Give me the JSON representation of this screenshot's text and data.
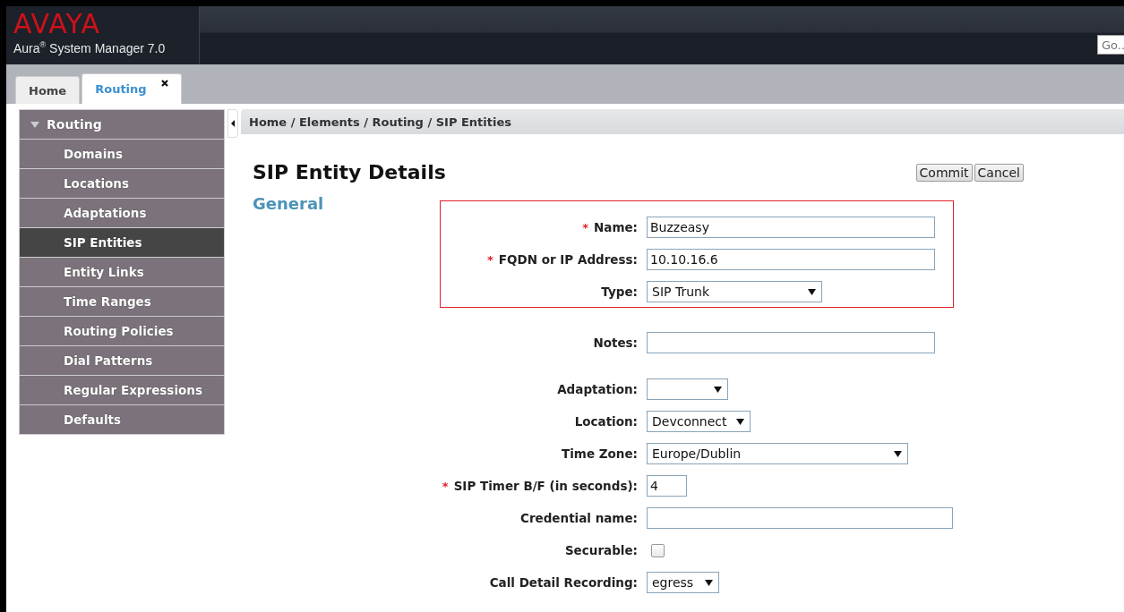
{
  "header": {
    "logo": "AVAYA",
    "product": "Aura",
    "product_mark": "®",
    "product_suffix": "System Manager 7.0",
    "search": {
      "placeholder": "Go.."
    }
  },
  "tabs": [
    {
      "label": "Home",
      "selected": false,
      "closable": false
    },
    {
      "label": "Routing",
      "selected": true,
      "closable": true
    }
  ],
  "sidebar": {
    "title": "Routing",
    "expanded": true,
    "items": [
      {
        "label": "Domains",
        "selected": false
      },
      {
        "label": "Locations",
        "selected": false
      },
      {
        "label": "Adaptations",
        "selected": false
      },
      {
        "label": "SIP Entities",
        "selected": true
      },
      {
        "label": "Entity Links",
        "selected": false
      },
      {
        "label": "Time Ranges",
        "selected": false
      },
      {
        "label": "Routing Policies",
        "selected": false
      },
      {
        "label": "Dial Patterns",
        "selected": false
      },
      {
        "label": "Regular Expressions",
        "selected": false
      },
      {
        "label": "Defaults",
        "selected": false
      }
    ]
  },
  "breadcrumb": "Home / Elements / Routing / SIP Entities",
  "page_title": "SIP Entity Details",
  "buttons": [
    "Commit",
    "Cancel"
  ],
  "section": "General",
  "field_groups": [
    {
      "highlighted": true,
      "fields": [
        {
          "kind": "text",
          "label": "Name:",
          "required_mark": "*",
          "value": "Buzzeasy"
        },
        {
          "kind": "text",
          "label": "FQDN or IP Address:",
          "required_mark": "*",
          "value": "10.10.16.6"
        },
        {
          "kind": "select",
          "label": "Type:",
          "value": "SIP Trunk"
        }
      ]
    },
    {
      "highlighted": false,
      "fields": [
        {
          "kind": "text",
          "label": "Notes:"
        }
      ]
    },
    {
      "highlighted": false,
      "fields": [
        {
          "kind": "select",
          "label": "Adaptation:"
        },
        {
          "kind": "select",
          "label": "Location:",
          "value": "Devconnect"
        },
        {
          "kind": "select",
          "label": "Time Zone:",
          "value": "Europe/Dublin"
        },
        {
          "kind": "text",
          "label": "SIP Timer B/F (in seconds):",
          "required_mark": "*",
          "value": "4"
        },
        {
          "kind": "text",
          "label": "Credential name:"
        },
        {
          "kind": "checkbox",
          "label": "Securable:",
          "checked": false
        },
        {
          "kind": "select",
          "label": "Call Detail Recording:",
          "value": "egress"
        }
      ]
    }
  ]
}
